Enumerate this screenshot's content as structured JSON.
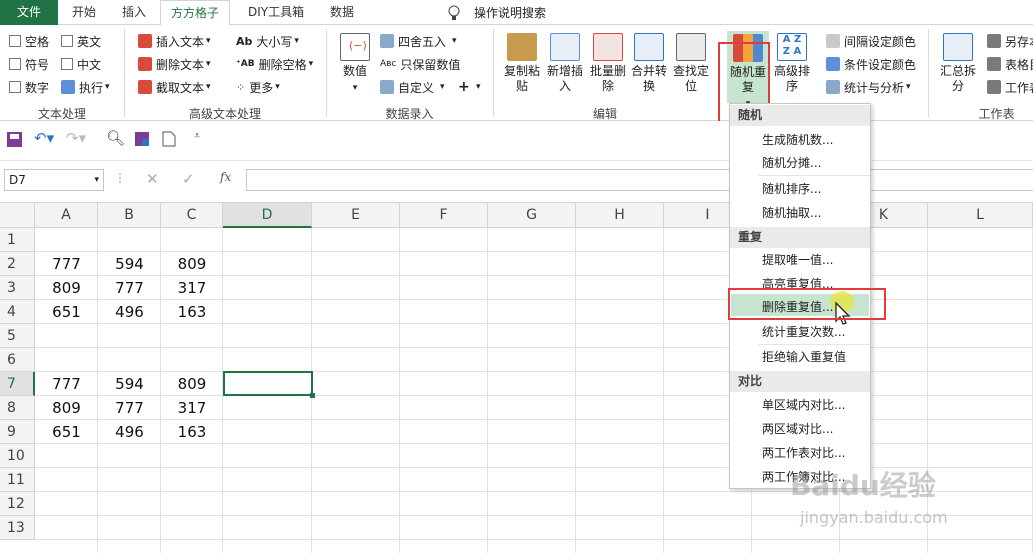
{
  "tabs": [
    "文件",
    "开始",
    "插入",
    "方方格子",
    "DIY工具箱",
    "数据"
  ],
  "search_hint": "操作说明搜索",
  "ribbon": {
    "text_proc": {
      "items": [
        "空格",
        "英文",
        "符号",
        "中文",
        "数字",
        "执行"
      ],
      "label": "文本处理"
    },
    "adv_text": {
      "items": [
        "插入文本",
        "删除文本",
        "截取文本",
        "大小写",
        "删除空格",
        "更多"
      ],
      "label": "高级文本处理"
    },
    "number_entry": {
      "big": "数值",
      "items": [
        "四舍五入",
        "只保留数值",
        "自定义"
      ],
      "plus": "+",
      "label": "数据录入"
    },
    "edit": {
      "buttons": [
        "复制粘贴",
        "新增插入",
        "批量删除",
        "合并转换",
        "查找定位"
      ],
      "label": "编辑"
    },
    "random_repeat": {
      "big": "随机重复",
      "sort": "高级排序"
    },
    "misc": [
      "间隔设定颜色",
      "条件设定颜色",
      "统计与分析"
    ],
    "right": {
      "big": "汇总拆分",
      "items": [
        "另存本",
        "表格目",
        "工作表"
      ],
      "label": "工作表"
    }
  },
  "namebox": "D7",
  "fx": "fx",
  "columns": [
    "A",
    "B",
    "C",
    "D",
    "E",
    "F",
    "G",
    "H",
    "I",
    "J",
    "K",
    "L"
  ],
  "rows": [
    "1",
    "2",
    "3",
    "4",
    "5",
    "6",
    "7",
    "8",
    "9",
    "10",
    "11",
    "12",
    "13"
  ],
  "cells": [
    {
      "r": 2,
      "vals": [
        "777",
        "594",
        "809"
      ]
    },
    {
      "r": 3,
      "vals": [
        "809",
        "777",
        "317"
      ]
    },
    {
      "r": 4,
      "vals": [
        "651",
        "496",
        "163"
      ]
    },
    {
      "r": 7,
      "vals": [
        "777",
        "594",
        "809"
      ]
    },
    {
      "r": 8,
      "vals": [
        "809",
        "777",
        "317"
      ]
    },
    {
      "r": 9,
      "vals": [
        "651",
        "496",
        "163"
      ]
    }
  ],
  "menu": {
    "sections": [
      {
        "title": "随机",
        "items": [
          "生成随机数...",
          "随机分摊...",
          "随机排序...",
          "随机抽取..."
        ]
      },
      {
        "title": "重复",
        "items": [
          "提取唯一值...",
          "高亮重复值...",
          "删除重复值...",
          "统计重复次数...",
          "拒绝输入重复值"
        ]
      },
      {
        "title": "对比",
        "items": [
          "单区域内对比...",
          "两区域对比...",
          "两工作表对比...",
          "两工作簿对比..."
        ]
      }
    ]
  },
  "watermark": "Baidu经验",
  "watermark_url": "jingyan.baidu.com"
}
